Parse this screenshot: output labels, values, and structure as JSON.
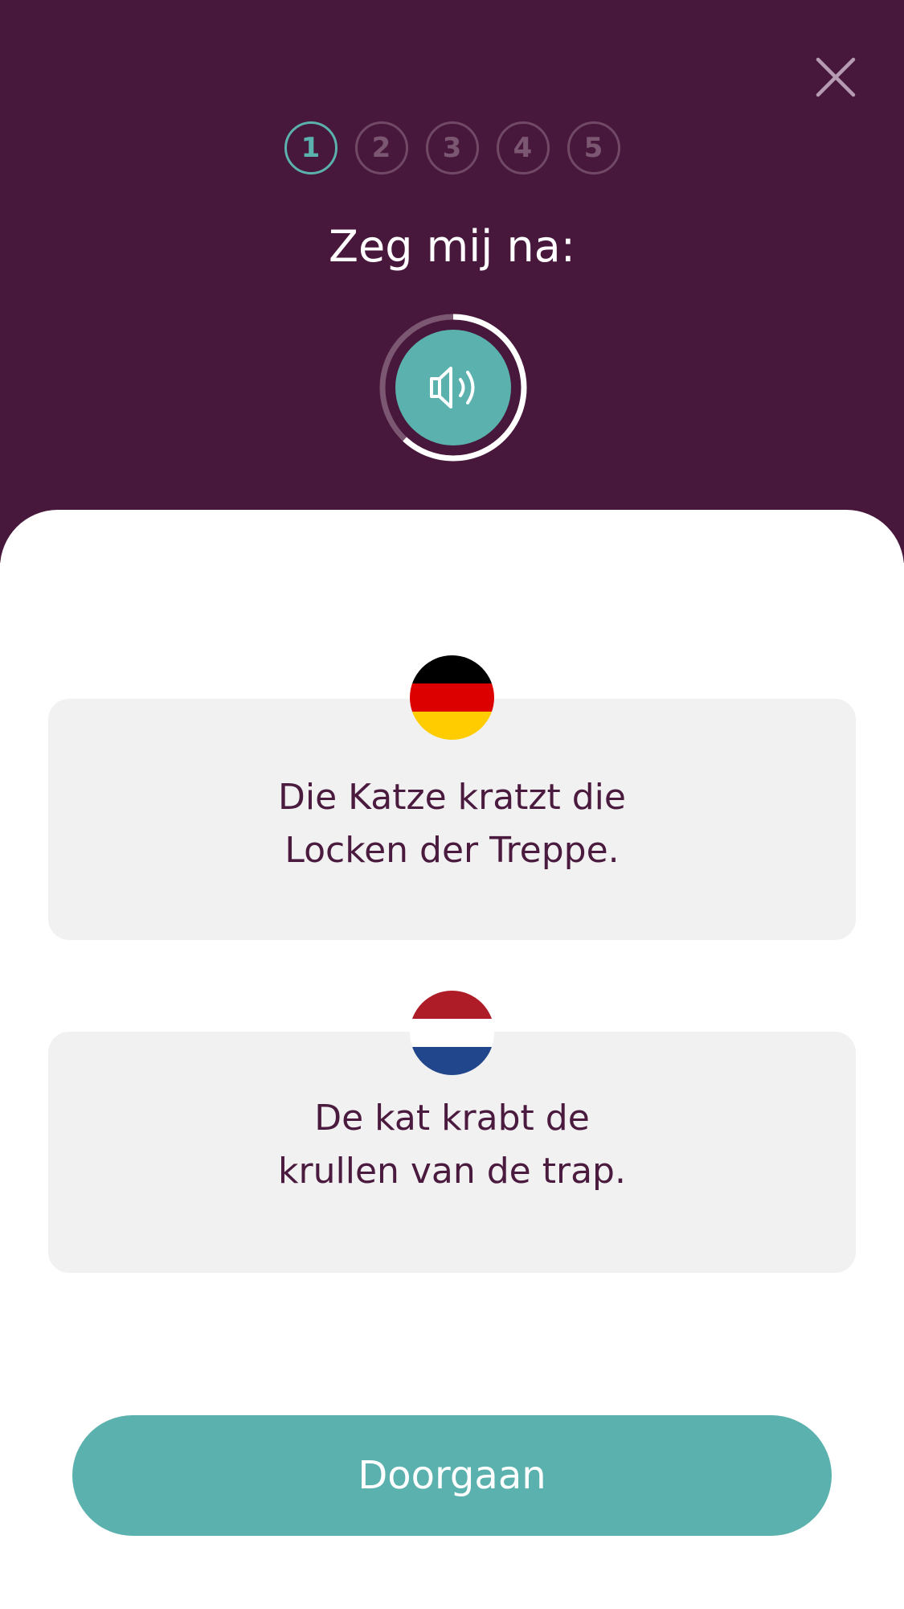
{
  "header": {
    "close_icon": "close-icon",
    "steps": [
      "1",
      "2",
      "3",
      "4",
      "5"
    ],
    "active_step": 1,
    "title": "Zeg mij na:",
    "audio": {
      "icon": "speaker-icon",
      "progress": 0.62
    }
  },
  "cards": {
    "source": {
      "flag": "germany-flag",
      "lines": [
        "Die Katze kratzt die",
        "Locken der Treppe."
      ]
    },
    "target": {
      "flag": "netherlands-flag",
      "lines": [
        "De kat krabt de",
        "krullen van de trap."
      ]
    }
  },
  "footer": {
    "continue_label": "Doorgaan"
  },
  "colors": {
    "header_bg": "#48173c",
    "accent": "#5ab1ad",
    "card_bg": "#f1f1f1",
    "text_dark": "#4a1a3f"
  }
}
